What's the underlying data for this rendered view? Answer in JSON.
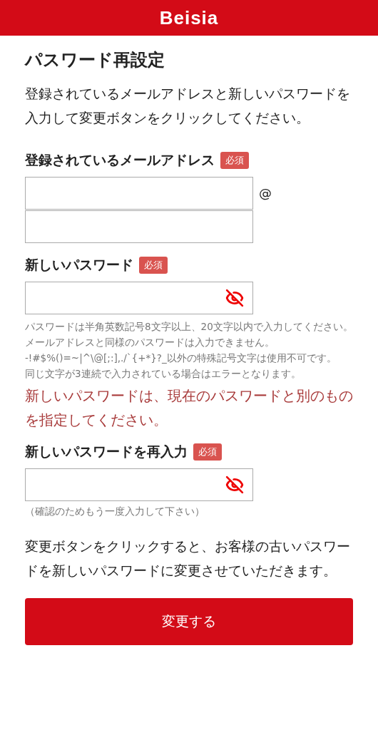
{
  "header": {
    "logo": "Beisia"
  },
  "title": "パスワード再設定",
  "intro": "登録されているメールアドレスと新しいパスワードを入力して変更ボタンをクリックしてください。",
  "email": {
    "label": "登録されているメールアドレス",
    "badge": "必須",
    "at": "@"
  },
  "new_password": {
    "label": "新しいパスワード",
    "badge": "必須",
    "visible": false,
    "notes": [
      "パスワードは半角英数記号8文字以上、20文字以内で入力してください。",
      "メールアドレスと同様のパスワードは入力できません。",
      "-!#$%()=~|^\\@[;:],./`{+*}?_以外の特殊記号文字は使用不可です。",
      "同じ文字が3連続で入力されている場合はエラーとなります。"
    ],
    "error": "新しいパスワードは、現在のパスワードと別のものを指定してください。"
  },
  "confirm_password": {
    "label": "新しいパスワードを再入力",
    "badge": "必須",
    "visible": false,
    "hint": "（確認のためもう一度入力して下さい）"
  },
  "outro": "変更ボタンをクリックすると、お客様の古いパスワードを新しいパスワードに変更させていただきます。",
  "submit": "変更する"
}
